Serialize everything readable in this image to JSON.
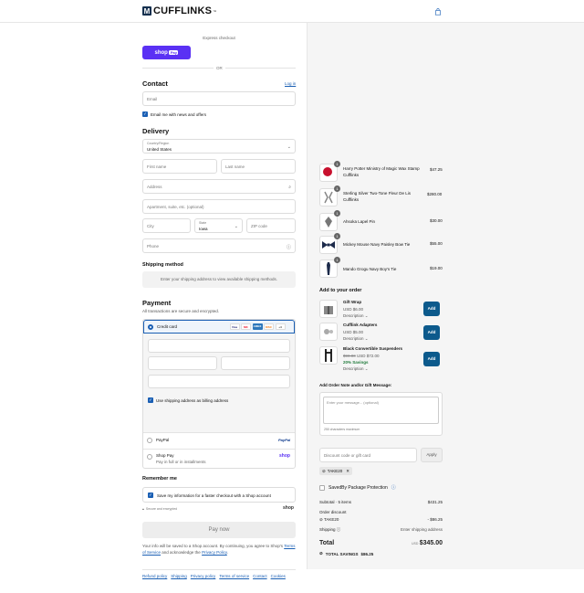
{
  "brand": {
    "name": "CUFFLINKS",
    "tm": "™"
  },
  "express": {
    "label": "Express checkout",
    "shop_pay": "shop",
    "shop_pay_badge": "Pay",
    "or": "OR"
  },
  "contact": {
    "title": "Contact",
    "login": "Log in",
    "email_placeholder": "Email",
    "news_label": "Email me with news and offers"
  },
  "delivery": {
    "title": "Delivery",
    "country_label": "Country/Region",
    "country_value": "United States",
    "first_name": "First name",
    "last_name": "Last name",
    "address": "Address",
    "apartment": "Apartment, suite, etc. (optional)",
    "city": "City",
    "state_label": "State",
    "state_value": "Iowa",
    "zip": "ZIP code",
    "phone": "Phone"
  },
  "shipping": {
    "title": "Shipping method",
    "message": "Enter your shipping address to view available shipping methods."
  },
  "payment": {
    "title": "Payment",
    "subtitle": "All transactions are secure and encrypted.",
    "credit_card": "Credit card",
    "card_logos": [
      "Visa",
      "MC",
      "AMEX",
      "DISC",
      "+4"
    ],
    "billing_same": "Use shipping address as billing address",
    "paypal": "PayPal",
    "shop_pay": "Shop Pay",
    "shop_pay_sub": "Pay in full or in installments",
    "shop_pay_logo": "shop"
  },
  "remember": {
    "title": "Remember me",
    "save_label": "Save my information for a faster checkout with a Shop account",
    "secure": "Secure and encrypted",
    "shop_logo": "shop"
  },
  "pay_now": "Pay now",
  "legal": {
    "text1": "Your info will be saved to a Shop account. By continuing, you agree to Shop's",
    "tos": "Terms of Service",
    "and": "and acknowledge the",
    "privacy": "Privacy Policy",
    "period": "."
  },
  "footer_links": [
    "Refund policy",
    "Shipping",
    "Privacy policy",
    "Terms of service",
    "Contact",
    "Cookies"
  ],
  "cart": {
    "items": [
      {
        "name": "Harry Potter Ministry of Magic Wax Stamp Cufflinks",
        "price": "$47.25",
        "qty": "1"
      },
      {
        "name": "Sterling Silver Two-Tone Fleur De Lis Cufflinks",
        "price": "$280.00",
        "qty": "1"
      },
      {
        "name": "Ahsoka Lapel Pin",
        "price": "$30.00",
        "qty": "1"
      },
      {
        "name": "Mickey Mouse Navy Paisley Bow Tie",
        "price": "$55.00",
        "qty": "1"
      },
      {
        "name": "Mando Grogu Navy Boy's Tie",
        "price": "$19.00",
        "qty": "1"
      }
    ],
    "add_title": "Add to your order",
    "upsells": [
      {
        "name": "Gift Wrap",
        "price": "USD $6.00",
        "old": "",
        "savings": "",
        "desc": "Description",
        "btn": "Add"
      },
      {
        "name": "Cufflink Adapters",
        "price": "USD $5.00",
        "old": "",
        "savings": "",
        "desc": "Description",
        "btn": "Add"
      },
      {
        "name": "Black Convertible Suspenders",
        "price": "USD $72.00",
        "old": "$90.00",
        "savings": "20% Savings",
        "desc": "Description",
        "btn": "Add"
      }
    ],
    "note_title": "Add Order Note and/or Gift Message:",
    "note_placeholder": "Enter your message... (optional)",
    "note_max": "250 characters maximum",
    "discount_placeholder": "Discount code or gift card",
    "apply": "Apply",
    "code": "TAKE20",
    "savedby": "SavedBy Package Protection",
    "subtotal_label": "Subtotal · 5 items",
    "subtotal": "$431.25",
    "order_discount": "Order discount",
    "discount_code": "TAKE20",
    "discount_value": "- $86.25",
    "shipping_label": "Shipping",
    "shipping_value": "Enter shipping address",
    "total_label": "Total",
    "currency": "USD",
    "total": "$345.00",
    "total_savings_label": "TOTAL SAVINGS",
    "total_savings": "$86.25"
  },
  "colors": {
    "accent": "#1a5fb4",
    "shop_purple": "#5a31f4",
    "add_button": "#0c5a8c"
  }
}
